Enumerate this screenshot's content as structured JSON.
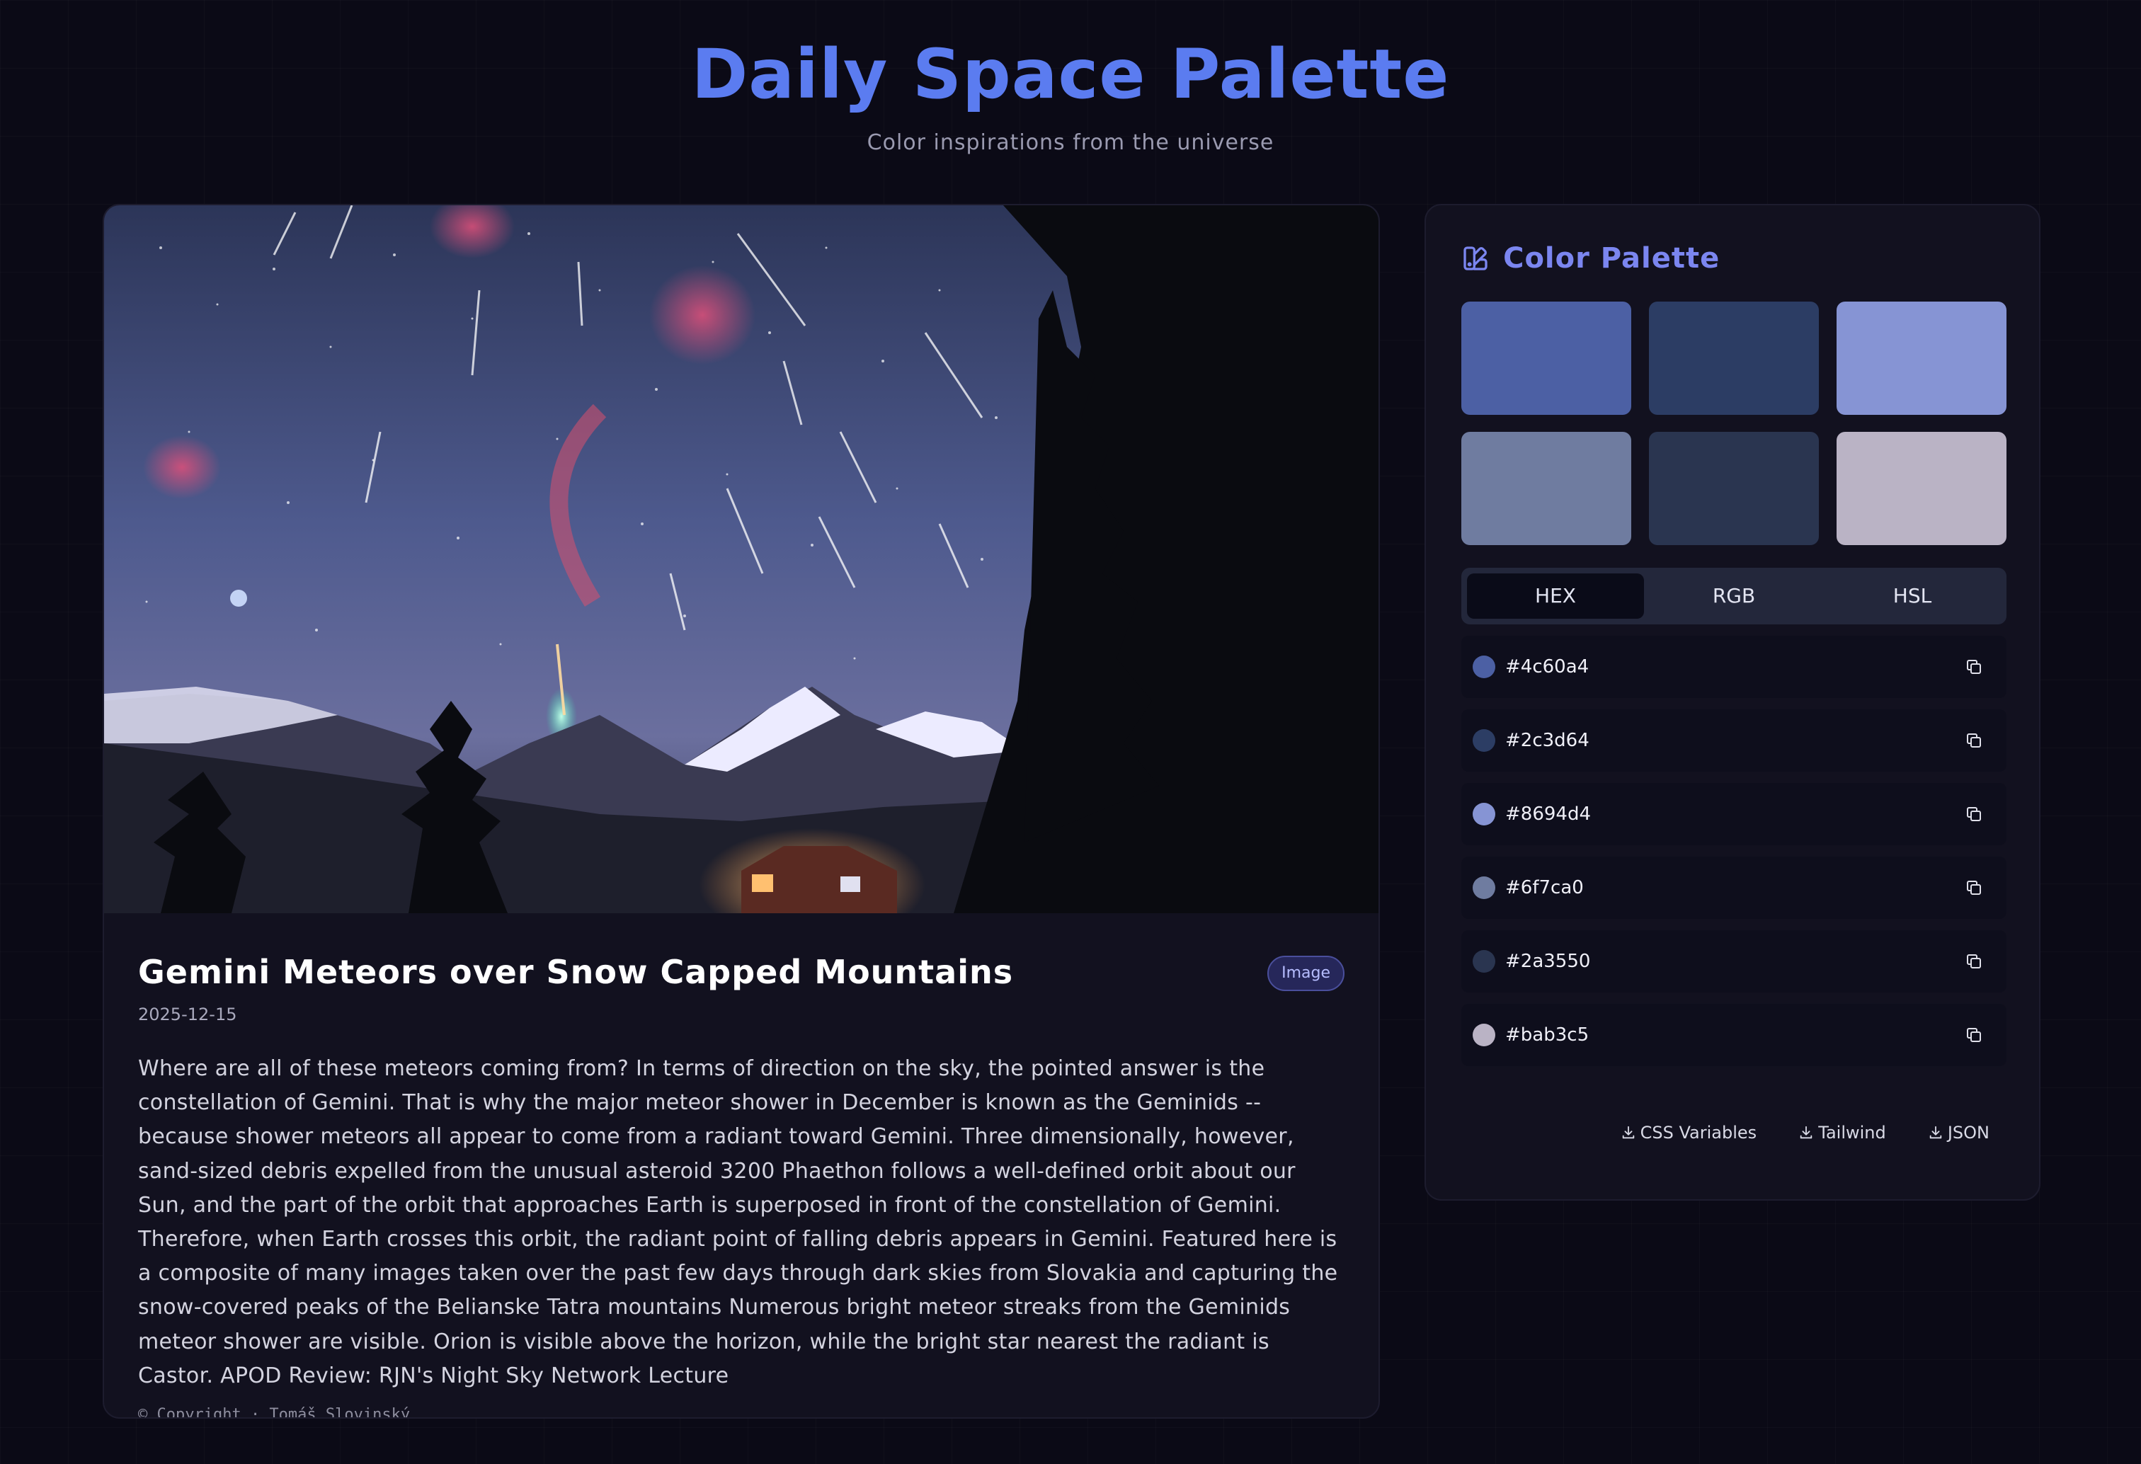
{
  "header": {
    "title": "Daily Space Palette",
    "subtitle": "Color inspirations from the universe"
  },
  "apod": {
    "title": "Gemini Meteors over Snow Capped Mountains",
    "media_type": "Image",
    "date": "2025-12-15",
    "explanation": "Where are all of these meteors coming from? In terms of direction on the sky, the pointed answer is the constellation of Gemini. That is why the major meteor shower in December is known as the Geminids -- because shower meteors all appear to come from a radiant toward Gemini. Three dimensionally, however, sand-sized debris expelled from the unusual asteroid 3200 Phaethon follows a well-defined orbit about our Sun, and the part of the orbit that approaches Earth is superposed in front of the constellation of Gemini. Therefore, when Earth crosses this orbit, the radiant point of falling debris appears in Gemini. Featured here is a composite of many images taken over the past few days through dark skies from Slovakia and capturing the snow-covered peaks of the Belianske Tatra mountains Numerous bright meteor streaks from the Geminids meteor shower are visible. Orion is visible above the horizon, while the bright star nearest the radiant is Castor. APOD Review: RJN's Night Sky Network Lecture",
    "copyright": "© Copyright · Tomáš Slovinský"
  },
  "palette": {
    "title": "Color Palette",
    "icon": "palette-icon",
    "swatches": [
      "#4c60a4",
      "#2c3d64",
      "#8694d4",
      "#6f7ca0",
      "#2a3550",
      "#bab3c5"
    ],
    "tabs": [
      {
        "label": "HEX",
        "active": true
      },
      {
        "label": "RGB",
        "active": false
      },
      {
        "label": "HSL",
        "active": false
      }
    ],
    "colors": [
      {
        "hex": "#4c60a4"
      },
      {
        "hex": "#2c3d64"
      },
      {
        "hex": "#8694d4"
      },
      {
        "hex": "#6f7ca0"
      },
      {
        "hex": "#2a3550"
      },
      {
        "hex": "#bab3c5"
      }
    ],
    "exports": [
      {
        "label": "CSS Variables",
        "icon": "download-icon"
      },
      {
        "label": "Tailwind",
        "icon": "download-icon"
      },
      {
        "label": "JSON",
        "icon": "download-icon"
      }
    ]
  },
  "theme": {
    "accent": "#5b7cf0",
    "background": "#0b0a16",
    "card": "#12111f"
  }
}
